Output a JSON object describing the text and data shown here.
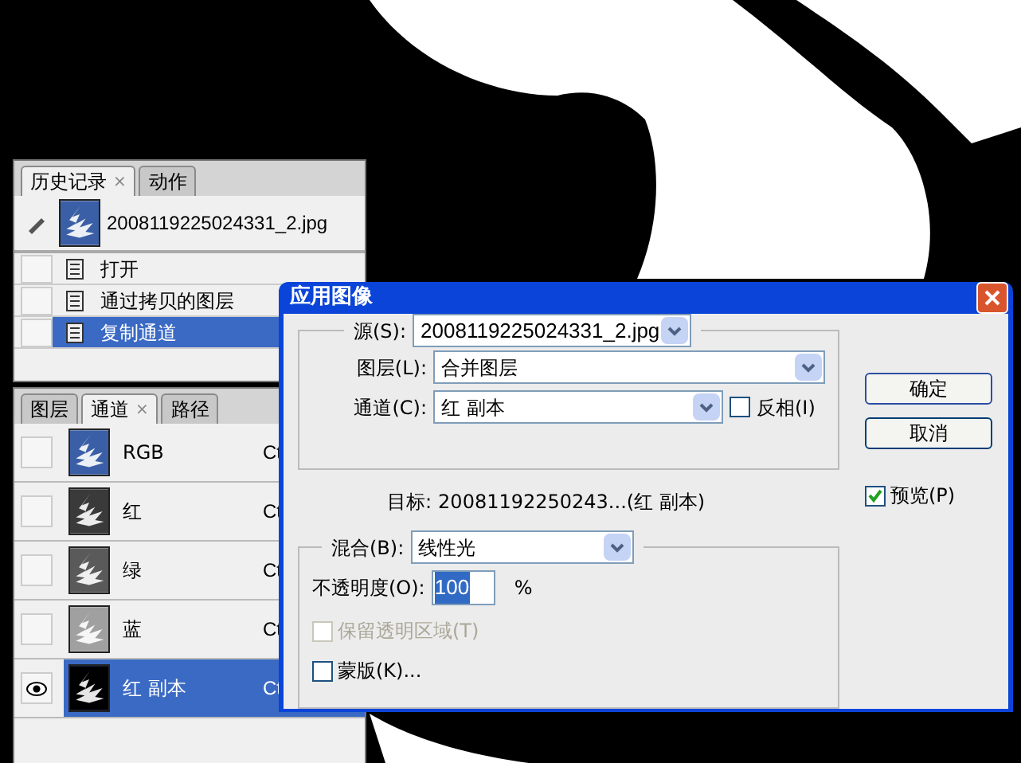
{
  "history_panel": {
    "tabs": [
      {
        "label": "历史记录",
        "selected": true,
        "close": "×"
      },
      {
        "label": "动作",
        "selected": false
      }
    ],
    "snapshot": {
      "name": "2008119225024331_2.jpg"
    },
    "items": [
      {
        "label": "打开",
        "selected": false,
        "source": false
      },
      {
        "label": "通过拷贝的图层",
        "selected": false,
        "source": false
      },
      {
        "label": "复制通道",
        "selected": true,
        "source": false
      }
    ]
  },
  "channels_panel": {
    "tabs": [
      {
        "label": "图层",
        "selected": false
      },
      {
        "label": "通道",
        "selected": true,
        "close": "×"
      },
      {
        "label": "路径",
        "selected": false
      }
    ],
    "channels": [
      {
        "name": "RGB",
        "shortcut": "Ct",
        "visible": false,
        "selected": false,
        "color": "#3b5fa6"
      },
      {
        "name": "红",
        "shortcut": "Ct",
        "visible": false,
        "selected": false,
        "color": "#3a3a3a"
      },
      {
        "name": "绿",
        "shortcut": "Ct",
        "visible": false,
        "selected": false,
        "color": "#5a5a5a"
      },
      {
        "name": "蓝",
        "shortcut": "Ct",
        "visible": false,
        "selected": false,
        "color": "#a0a0a0"
      },
      {
        "name": "红 副本",
        "shortcut": "Ct",
        "visible": true,
        "selected": true,
        "color": "#000000"
      }
    ]
  },
  "dialog": {
    "title": "应用图像",
    "source": {
      "label": "源(S):",
      "value": "2008119225024331_2.jpg"
    },
    "layer": {
      "label": "图层(L):",
      "value": "合并图层"
    },
    "channel": {
      "label": "通道(C):",
      "value": "红 副本"
    },
    "invert": {
      "label": "反相(I)",
      "checked": false
    },
    "target": {
      "label": "目标:",
      "value": "20081192250243...(红 副本)"
    },
    "blend": {
      "label": "混合(B):",
      "value": "线性光"
    },
    "opacity": {
      "label": "不透明度(O):",
      "value": "100",
      "unit": "%"
    },
    "preserve_transparency": {
      "label": "保留透明区域(T)",
      "checked": false,
      "disabled": true
    },
    "mask": {
      "label": "蒙版(K)...",
      "checked": false
    },
    "buttons": [
      "确定",
      "取消"
    ],
    "preview": {
      "label": "预览(P)",
      "checked": true
    }
  }
}
